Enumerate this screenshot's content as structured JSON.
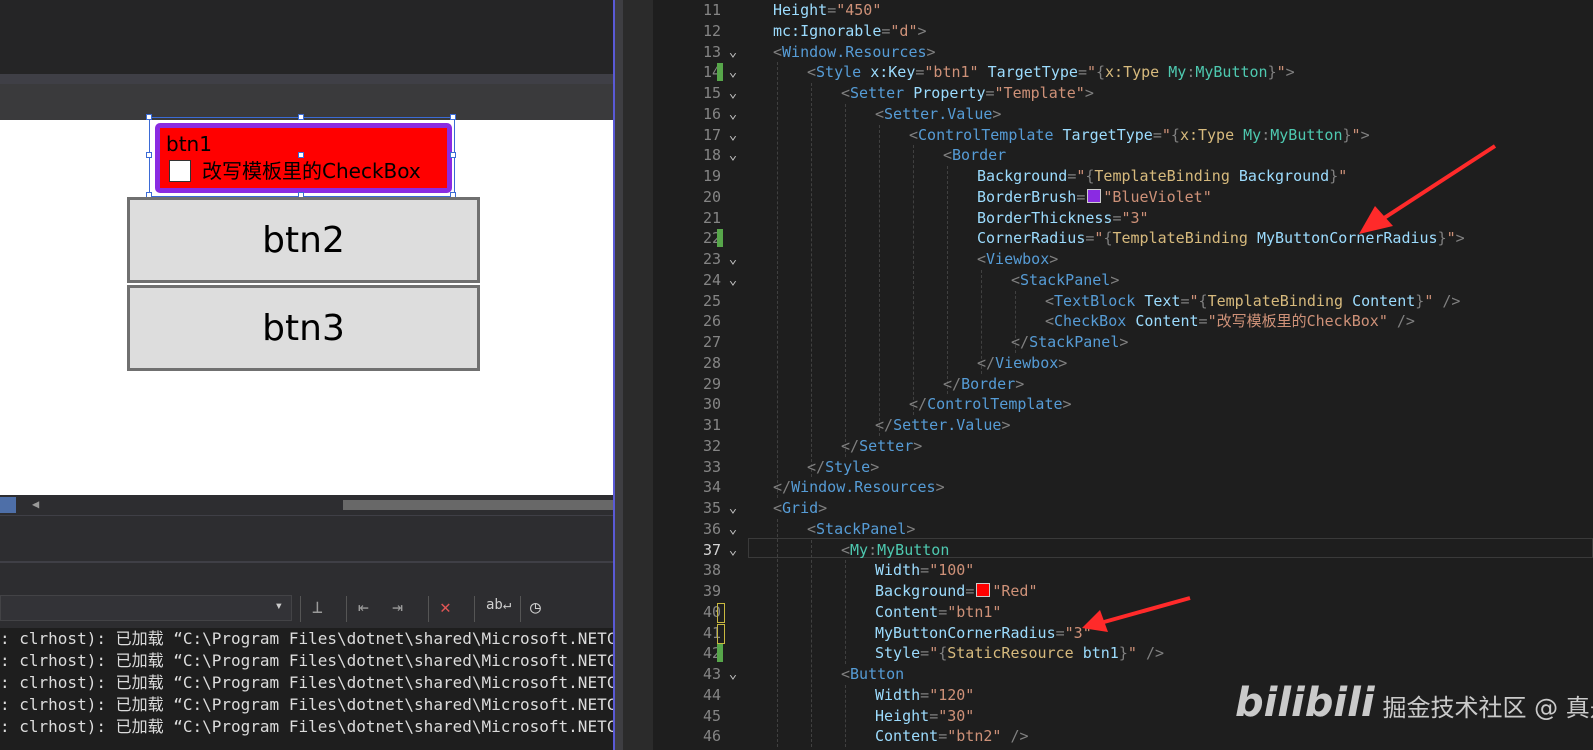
{
  "designer": {
    "btn1": {
      "content": "btn1",
      "checkbox_label": "改写模板里的CheckBox"
    },
    "btn2": {
      "content": "btn2"
    },
    "btn3": {
      "content": "btn3"
    }
  },
  "output": {
    "lines": [
      ": clrhost): 已加载 “C:\\Program Files\\dotnet\\shared\\Microsoft.NETCore.A",
      ": clrhost): 已加载 “C:\\Program Files\\dotnet\\shared\\Microsoft.NETCore.A",
      ": clrhost): 已加载 “C:\\Program Files\\dotnet\\shared\\Microsoft.NETCore.A",
      ": clrhost): 已加载 “C:\\Program Files\\dotnet\\shared\\Microsoft.NETCore.A",
      ": clrhost): 已加载 “C:\\Program Files\\dotnet\\shared\\Microsoft.NETCore.A"
    ]
  },
  "colors": {
    "red": "#ff0000",
    "blueviolet": "#8a2be2"
  },
  "editor": {
    "current_line": 37,
    "lines": [
      {
        "n": "11",
        "fold": "",
        "mark": "",
        "indent": 0,
        "code": [
          [
            "a",
            "Height"
          ],
          [
            "p",
            "="
          ],
          [
            "v",
            "\"450\""
          ]
        ]
      },
      {
        "n": "12",
        "fold": "",
        "mark": "",
        "indent": 0,
        "code": [
          [
            "a",
            "mc:Ignorable"
          ],
          [
            "p",
            "="
          ],
          [
            "v",
            "\"d\""
          ],
          [
            "p",
            ">"
          ]
        ]
      },
      {
        "n": "13",
        "fold": "⌄",
        "mark": "",
        "indent": 0,
        "code": [
          [
            "p",
            "<"
          ],
          [
            "t",
            "Window.Resources"
          ],
          [
            "p",
            ">"
          ]
        ]
      },
      {
        "n": "14",
        "fold": "⌄",
        "mark": "green",
        "indent": 1,
        "code": [
          [
            "p",
            "<"
          ],
          [
            "t",
            "Style"
          ],
          [
            "s",
            " "
          ],
          [
            "a",
            "x:Key"
          ],
          [
            "p",
            "="
          ],
          [
            "v",
            "\"btn1\""
          ],
          [
            "s",
            " "
          ],
          [
            "a",
            "TargetType"
          ],
          [
            "p",
            "="
          ],
          [
            "v",
            "\""
          ],
          [
            "p",
            "{"
          ],
          [
            "mk",
            "x:Type "
          ],
          [
            "tn",
            "My"
          ],
          [
            "p",
            ":"
          ],
          [
            "tn",
            "MyButton"
          ],
          [
            "p",
            "}"
          ],
          [
            "v",
            "\""
          ],
          [
            "p",
            ">"
          ]
        ]
      },
      {
        "n": "15",
        "fold": "⌄",
        "mark": "",
        "indent": 2,
        "code": [
          [
            "p",
            "<"
          ],
          [
            "t",
            "Setter"
          ],
          [
            "s",
            " "
          ],
          [
            "a",
            "Property"
          ],
          [
            "p",
            "="
          ],
          [
            "v",
            "\"Template\""
          ],
          [
            "p",
            ">"
          ]
        ]
      },
      {
        "n": "16",
        "fold": "⌄",
        "mark": "",
        "indent": 3,
        "code": [
          [
            "p",
            "<"
          ],
          [
            "t",
            "Setter.Value"
          ],
          [
            "p",
            ">"
          ]
        ]
      },
      {
        "n": "17",
        "fold": "⌄",
        "mark": "",
        "indent": 4,
        "code": [
          [
            "p",
            "<"
          ],
          [
            "t",
            "ControlTemplate"
          ],
          [
            "s",
            " "
          ],
          [
            "a",
            "TargetType"
          ],
          [
            "p",
            "="
          ],
          [
            "v",
            "\""
          ],
          [
            "p",
            "{"
          ],
          [
            "mk",
            "x:Type "
          ],
          [
            "tn",
            "My"
          ],
          [
            "p",
            ":"
          ],
          [
            "tn",
            "MyButton"
          ],
          [
            "p",
            "}"
          ],
          [
            "v",
            "\""
          ],
          [
            "p",
            ">"
          ]
        ]
      },
      {
        "n": "18",
        "fold": "⌄",
        "mark": "",
        "indent": 5,
        "code": [
          [
            "p",
            "<"
          ],
          [
            "t",
            "Border"
          ]
        ]
      },
      {
        "n": "19",
        "fold": "",
        "mark": "",
        "indent": 6,
        "code": [
          [
            "a",
            "Background"
          ],
          [
            "p",
            "="
          ],
          [
            "v",
            "\""
          ],
          [
            "p",
            "{"
          ],
          [
            "mk",
            "TemplateBinding "
          ],
          [
            "a",
            "Background"
          ],
          [
            "p",
            "}"
          ],
          [
            "v",
            "\""
          ]
        ]
      },
      {
        "n": "20",
        "fold": "",
        "mark": "",
        "indent": 6,
        "code": [
          [
            "a",
            "BorderBrush"
          ],
          [
            "p",
            "="
          ],
          [
            "sw",
            "blueviolet"
          ],
          [
            "v",
            "\"BlueViolet\""
          ]
        ]
      },
      {
        "n": "21",
        "fold": "",
        "mark": "",
        "indent": 6,
        "code": [
          [
            "a",
            "BorderThickness"
          ],
          [
            "p",
            "="
          ],
          [
            "v",
            "\"3\""
          ]
        ]
      },
      {
        "n": "22",
        "fold": "",
        "mark": "green",
        "indent": 6,
        "code": [
          [
            "a",
            "CornerRadius"
          ],
          [
            "p",
            "="
          ],
          [
            "v",
            "\""
          ],
          [
            "p",
            "{"
          ],
          [
            "mk",
            "TemplateBinding "
          ],
          [
            "a",
            "MyButtonCornerRadius"
          ],
          [
            "p",
            "}"
          ],
          [
            "v",
            "\""
          ],
          [
            "p",
            ">"
          ]
        ]
      },
      {
        "n": "23",
        "fold": "⌄",
        "mark": "",
        "indent": 6,
        "code": [
          [
            "p",
            "<"
          ],
          [
            "t",
            "Viewbox"
          ],
          [
            "p",
            ">"
          ]
        ]
      },
      {
        "n": "24",
        "fold": "⌄",
        "mark": "",
        "indent": 7,
        "code": [
          [
            "p",
            "<"
          ],
          [
            "t",
            "StackPanel"
          ],
          [
            "p",
            ">"
          ]
        ]
      },
      {
        "n": "25",
        "fold": "",
        "mark": "",
        "indent": 8,
        "code": [
          [
            "p",
            "<"
          ],
          [
            "t",
            "TextBlock"
          ],
          [
            "s",
            " "
          ],
          [
            "a",
            "Text"
          ],
          [
            "p",
            "="
          ],
          [
            "v",
            "\""
          ],
          [
            "p",
            "{"
          ],
          [
            "mk",
            "TemplateBinding "
          ],
          [
            "a",
            "Content"
          ],
          [
            "p",
            "}"
          ],
          [
            "v",
            "\""
          ],
          [
            "s",
            " "
          ],
          [
            "p",
            "/>"
          ]
        ]
      },
      {
        "n": "26",
        "fold": "",
        "mark": "",
        "indent": 8,
        "code": [
          [
            "p",
            "<"
          ],
          [
            "t",
            "CheckBox"
          ],
          [
            "s",
            " "
          ],
          [
            "a",
            "Content"
          ],
          [
            "p",
            "="
          ],
          [
            "v",
            "\"改写模板里的CheckBox\""
          ],
          [
            "s",
            " "
          ],
          [
            "p",
            "/>"
          ]
        ]
      },
      {
        "n": "27",
        "fold": "",
        "mark": "",
        "indent": 7,
        "code": [
          [
            "p",
            "</"
          ],
          [
            "t",
            "StackPanel"
          ],
          [
            "p",
            ">"
          ]
        ]
      },
      {
        "n": "28",
        "fold": "",
        "mark": "",
        "indent": 6,
        "code": [
          [
            "p",
            "</"
          ],
          [
            "t",
            "Viewbox"
          ],
          [
            "p",
            ">"
          ]
        ]
      },
      {
        "n": "29",
        "fold": "",
        "mark": "",
        "indent": 5,
        "code": [
          [
            "p",
            "</"
          ],
          [
            "t",
            "Border"
          ],
          [
            "p",
            ">"
          ]
        ]
      },
      {
        "n": "30",
        "fold": "",
        "mark": "",
        "indent": 4,
        "code": [
          [
            "p",
            "</"
          ],
          [
            "t",
            "ControlTemplate"
          ],
          [
            "p",
            ">"
          ]
        ]
      },
      {
        "n": "31",
        "fold": "",
        "mark": "",
        "indent": 3,
        "code": [
          [
            "p",
            "</"
          ],
          [
            "t",
            "Setter.Value"
          ],
          [
            "p",
            ">"
          ]
        ]
      },
      {
        "n": "32",
        "fold": "",
        "mark": "",
        "indent": 2,
        "code": [
          [
            "p",
            "</"
          ],
          [
            "t",
            "Setter"
          ],
          [
            "p",
            ">"
          ]
        ]
      },
      {
        "n": "33",
        "fold": "",
        "mark": "",
        "indent": 1,
        "code": [
          [
            "p",
            "</"
          ],
          [
            "t",
            "Style"
          ],
          [
            "p",
            ">"
          ]
        ]
      },
      {
        "n": "34",
        "fold": "",
        "mark": "",
        "indent": 0,
        "code": [
          [
            "p",
            "</"
          ],
          [
            "t",
            "Window.Resources"
          ],
          [
            "p",
            ">"
          ]
        ]
      },
      {
        "n": "35",
        "fold": "⌄",
        "mark": "",
        "indent": 0,
        "code": [
          [
            "p",
            "<"
          ],
          [
            "t",
            "Grid"
          ],
          [
            "p",
            ">"
          ]
        ]
      },
      {
        "n": "36",
        "fold": "⌄",
        "mark": "",
        "indent": 1,
        "code": [
          [
            "p",
            "<"
          ],
          [
            "t",
            "StackPanel"
          ],
          [
            "p",
            ">"
          ]
        ]
      },
      {
        "n": "37",
        "fold": "⌄",
        "mark": "",
        "indent": 2,
        "code": [
          [
            "p",
            "<"
          ],
          [
            "tn",
            "My"
          ],
          [
            "p",
            ":"
          ],
          [
            "tn",
            "MyButton"
          ]
        ]
      },
      {
        "n": "38",
        "fold": "",
        "mark": "",
        "indent": 3,
        "code": [
          [
            "a",
            "Width"
          ],
          [
            "p",
            "="
          ],
          [
            "v",
            "\"100\""
          ]
        ]
      },
      {
        "n": "39",
        "fold": "",
        "mark": "",
        "indent": 3,
        "code": [
          [
            "a",
            "Background"
          ],
          [
            "p",
            "="
          ],
          [
            "sw",
            "red"
          ],
          [
            "v",
            "\"Red\""
          ]
        ]
      },
      {
        "n": "40",
        "fold": "",
        "mark": "yellow",
        "indent": 3,
        "code": [
          [
            "a",
            "Content"
          ],
          [
            "p",
            "="
          ],
          [
            "v",
            "\"btn1\""
          ]
        ]
      },
      {
        "n": "41",
        "fold": "",
        "mark": "yellow",
        "indent": 3,
        "code": [
          [
            "a",
            "MyButtonCornerRadius"
          ],
          [
            "p",
            "="
          ],
          [
            "v",
            "\"3\""
          ]
        ]
      },
      {
        "n": "42",
        "fold": "",
        "mark": "green",
        "indent": 3,
        "code": [
          [
            "a",
            "Style"
          ],
          [
            "p",
            "="
          ],
          [
            "v",
            "\""
          ],
          [
            "p",
            "{"
          ],
          [
            "mk",
            "StaticResource "
          ],
          [
            "a",
            "btn1"
          ],
          [
            "p",
            "}"
          ],
          [
            "v",
            "\""
          ],
          [
            "s",
            " "
          ],
          [
            "p",
            "/>"
          ]
        ]
      },
      {
        "n": "43",
        "fold": "⌄",
        "mark": "",
        "indent": 2,
        "code": [
          [
            "p",
            "<"
          ],
          [
            "t",
            "Button"
          ]
        ]
      },
      {
        "n": "44",
        "fold": "",
        "mark": "",
        "indent": 3,
        "code": [
          [
            "a",
            "Width"
          ],
          [
            "p",
            "="
          ],
          [
            "v",
            "\"120\""
          ]
        ]
      },
      {
        "n": "45",
        "fold": "",
        "mark": "",
        "indent": 3,
        "code": [
          [
            "a",
            "Height"
          ],
          [
            "p",
            "="
          ],
          [
            "v",
            "\"30\""
          ]
        ]
      },
      {
        "n": "46",
        "fold": "",
        "mark": "",
        "indent": 3,
        "code": [
          [
            "a",
            "Content"
          ],
          [
            "p",
            "="
          ],
          [
            "v",
            "\"btn2\""
          ],
          [
            "s",
            " "
          ],
          [
            "p",
            "/>"
          ]
        ]
      }
    ]
  },
  "watermark": {
    "logo": "bilibili",
    "text": "掘金技术社区 @ 真是他"
  }
}
